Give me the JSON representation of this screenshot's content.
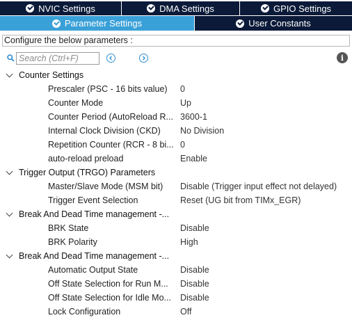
{
  "tabs": {
    "row1": [
      {
        "label": "NVIC Settings",
        "active": false
      },
      {
        "label": "DMA Settings",
        "active": false
      },
      {
        "label": "GPIO Settings",
        "active": false
      }
    ],
    "row2": [
      {
        "label": "Parameter Settings",
        "active": true
      },
      {
        "label": "User Constants",
        "active": false
      }
    ]
  },
  "configure_label": "Configure the below parameters :",
  "search": {
    "placeholder": "Search (Ctrl+F)",
    "value": ""
  },
  "colors": {
    "tab_dark": "#0b1a38",
    "tab_active": "#3aa0d8",
    "accent": "#2f8fd0"
  },
  "groups": [
    {
      "label": "Counter Settings",
      "params": [
        {
          "name": "Prescaler (PSC - 16 bits value)",
          "value": "0"
        },
        {
          "name": "Counter Mode",
          "value": "Up"
        },
        {
          "name": "Counter Period (AutoReload R...",
          "value": "3600-1"
        },
        {
          "name": "Internal Clock Division (CKD)",
          "value": "No Division"
        },
        {
          "name": "Repetition Counter (RCR - 8 bi...",
          "value": "0"
        },
        {
          "name": "auto-reload preload",
          "value": "Enable"
        }
      ]
    },
    {
      "label": "Trigger Output (TRGO) Parameters",
      "params": [
        {
          "name": "Master/Slave Mode (MSM bit)",
          "value": "Disable (Trigger input effect not delayed)"
        },
        {
          "name": "Trigger Event Selection",
          "value": "Reset (UG bit from TIMx_EGR)"
        }
      ]
    },
    {
      "label": "Break And Dead Time management -...",
      "params": [
        {
          "name": "BRK State",
          "value": "Disable"
        },
        {
          "name": "BRK Polarity",
          "value": "High"
        }
      ]
    },
    {
      "label": "Break And Dead Time management -...",
      "params": [
        {
          "name": "Automatic Output State",
          "value": "Disable"
        },
        {
          "name": "Off State Selection for Run M...",
          "value": "Disable"
        },
        {
          "name": "Off State Selection for Idle Mo...",
          "value": "Disable"
        },
        {
          "name": "Lock Configuration",
          "value": "Off"
        }
      ]
    }
  ]
}
